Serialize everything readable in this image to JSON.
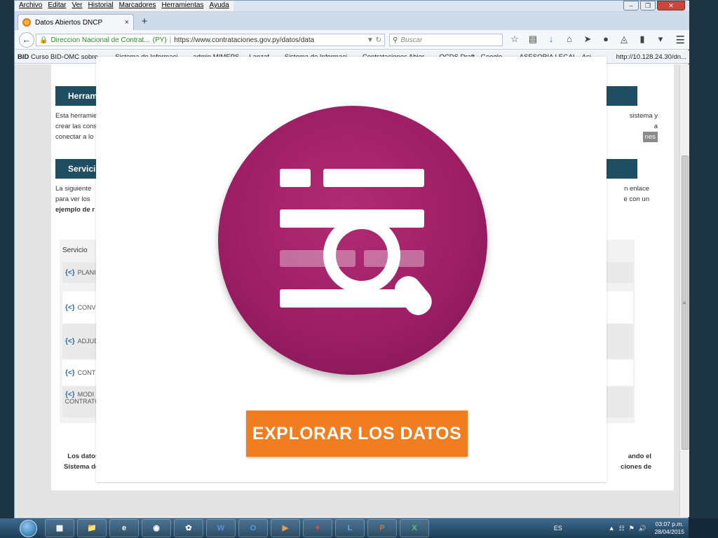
{
  "menubar": [
    "Archivo",
    "Editar",
    "Ver",
    "Historial",
    "Marcadores",
    "Herramientas",
    "Ayuda"
  ],
  "tab": {
    "title": "Datos Abiertos DNCP",
    "close": "×",
    "new_tab": "+"
  },
  "navbar": {
    "site_label": "Direccion Nacional de Contrat...",
    "site_country": "(PY)",
    "url": "https://www.contrataciones.gov.py/datos/data",
    "search_placeholder": "Buscar"
  },
  "bookmarks": [
    "Curso BID-OMC sobre ...",
    "Sistema de Informaci...",
    "admin MIMEPS",
    "Lanzaf...",
    "Sistema de Informaci...",
    "Contrataciones Abier...",
    "OCDS Draft - Google ...",
    "ASESORIA LEGAL - Asi...",
    "http://10.128.24.30/dn..."
  ],
  "bookmarks_first_tag": "BID",
  "page": {
    "band1": "Herram",
    "band1_text": [
      "Esta herramie",
      "crear las cons",
      "conectar a lo"
    ],
    "band1_right": [
      "sistema y",
      "a",
      "nes"
    ],
    "band2": "Servici",
    "band2_text": [
      "La siguiente",
      "para ver los",
      "ejemplo de r"
    ],
    "band2_right": [
      "n enlace",
      "e con un"
    ],
    "table_header": "Servicio",
    "rows": [
      "PLANI",
      "CONV",
      "ADJUD",
      "CONT",
      "MODI"
    ],
    "row_extra": "CONTRATO",
    "footer_left": [
      "Los datos",
      "Sistema de I"
    ],
    "footer_right": [
      "ando el",
      "ciones de"
    ]
  },
  "modal": {
    "button": "EXPLORAR LOS DATOS"
  },
  "taskbar": {
    "apps": [
      "W",
      "O",
      "P",
      "L",
      "P",
      "X"
    ],
    "lang": "ES",
    "time": "03:07 p.m.",
    "date": "28/04/2015"
  },
  "colors": {
    "accent_magenta": "#9e1f66",
    "button_orange": "#f07d1f",
    "band_blue": "#1f4e63"
  }
}
